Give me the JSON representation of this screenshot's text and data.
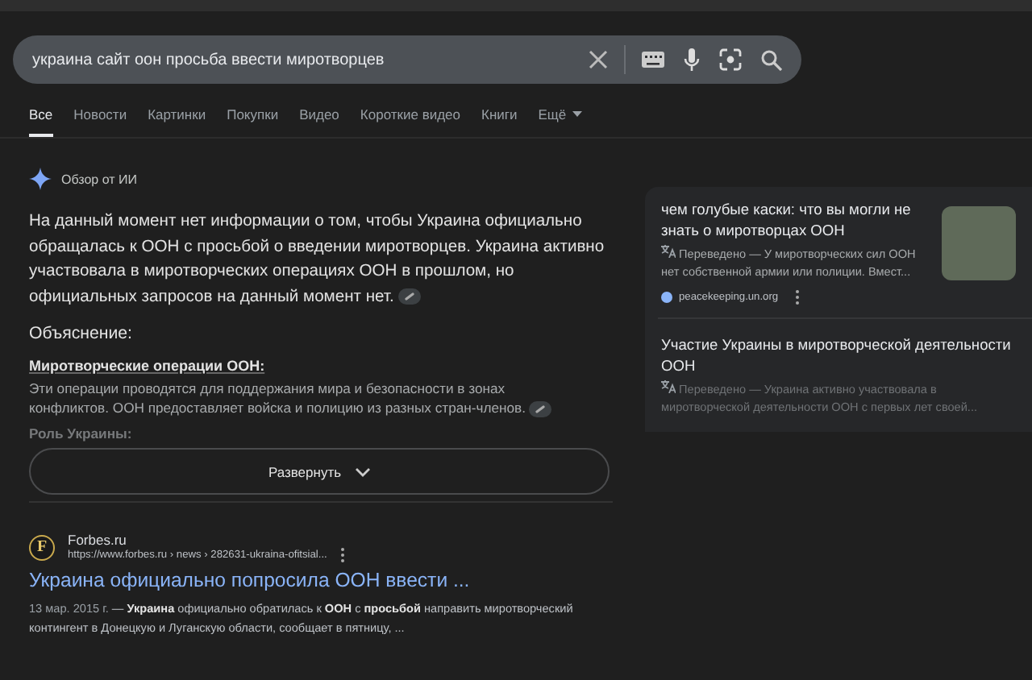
{
  "search": {
    "value": "украина сайт оон просьба ввести миротворцев"
  },
  "tabs": [
    {
      "label": "Все",
      "selected": true
    },
    {
      "label": "Новости",
      "selected": false
    },
    {
      "label": "Картинки",
      "selected": false
    },
    {
      "label": "Покупки",
      "selected": false
    },
    {
      "label": "Видео",
      "selected": false
    },
    {
      "label": "Короткие видео",
      "selected": false
    },
    {
      "label": "Книги",
      "selected": false
    },
    {
      "label": "Ещё",
      "selected": false,
      "kind": "menu"
    }
  ],
  "ai_overview": {
    "label": "Обзор от ИИ",
    "summary": "На данный момент нет информации о том, чтобы Украина официально обращалась к ООН с просьбой о введении миротворцев. Украина активно участвовала в миротворческих операциях ООН в прошлом, но официальных запросов на данный момент нет.",
    "explanation_heading": "Объяснение:",
    "section_heading": "Миротворческие операции ООН:",
    "section_text": "Эти операции проводятся для поддержания мира и безопасности в зонах конфликтов. ООН предоставляет войска и полицию из разных стран-членов.",
    "faded_heading": "Роль Украины:",
    "expand_button": "Развернуть"
  },
  "sources": [
    {
      "title": "чем голубые каски: что вы могли не знать о миротворцах ООН",
      "snippet": "Переведено — У миротворческих сил ООН нет собственной армии или полиции. Вмест...",
      "site": "peacekeeping.un.org",
      "has_image": true
    },
    {
      "title": "Участие Украины в миротворческой деятельности ООН",
      "snippet": "Переведено — Украина активно участвовала в миротворческой деятельности ООН с первых лет своей...",
      "has_image": false
    }
  ],
  "result": {
    "site_name": "Forbes.ru",
    "favicon_letter": "F",
    "url": "https://www.forbes.ru › news › 282631-ukraina-ofitsial...",
    "title": "Украина официально попросила ООН ввести ...",
    "date": "13 мар. 2015 г.",
    "snippet": " — **Украина** официально обратилась к **ООН** с **просьбой** направить миротворческий контингент в Донецкую и Луганскую области, сообщает в пятницу, ..."
  }
}
